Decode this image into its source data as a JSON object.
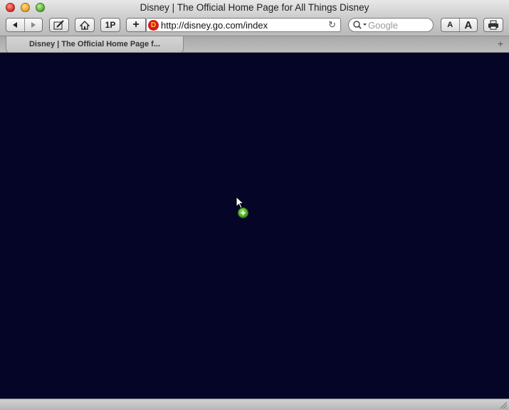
{
  "window": {
    "title": "Disney | The Official Home Page for All Things Disney"
  },
  "toolbar": {
    "back_icon": "back-arrow-icon",
    "forward_icon": "forward-arrow-icon",
    "edit_icon": "pencil-icon",
    "home_icon": "home-icon",
    "onepassword_label": "1P",
    "add_bookmark_label": "+",
    "url": "http://disney.go.com/index",
    "search_placeholder": "Google",
    "text_smaller_label": "A",
    "text_larger_label": "A",
    "print_icon": "printer-icon"
  },
  "tabs": [
    {
      "label": "Disney | The Official Home Page f..."
    }
  ],
  "new_tab_label": "+",
  "content": {
    "background_color": "#050627"
  },
  "cursor": {
    "icon": "arrow-cursor-icon",
    "badge_label": "+"
  }
}
